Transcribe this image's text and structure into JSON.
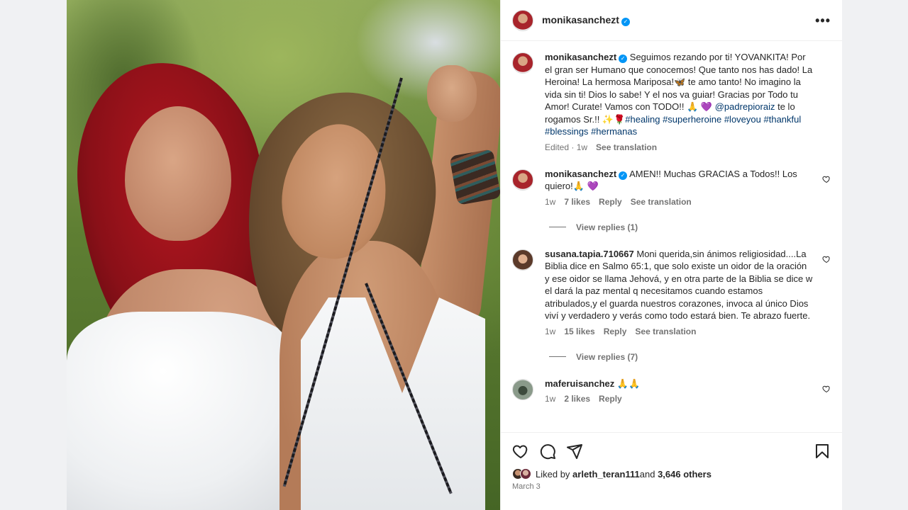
{
  "post": {
    "author": "monikasanchezt",
    "verified": true,
    "photo_alt": ""
  },
  "header": {
    "username": "monikasanchezt",
    "more": "•••"
  },
  "caption": {
    "username": "monikasanchezt",
    "text_part1": "Seguimos rezando por ti! YOVANKITA! Por el gran ser Humano que conocemos! Que tanto nos has dado! La Heroina! La hermosa Mariposa!🦋 te amo tanto! No imagino la vida sin ti! Dios lo sabe! Y el nos va guiar! Gracias por Todo tu Amor! Curate! Vamos con TODO!! 🙏 💜 ",
    "mention": "@padrepioraiz",
    "text_part2": " te lo rogamos Sr.!! ✨🌹",
    "hashtags": [
      "#healing",
      "#superheroine",
      "#loveyou",
      "#thankful",
      "#blessings",
      "#hermanas"
    ],
    "edited": "Edited",
    "time": "1w",
    "translate": "See translation"
  },
  "comments": [
    {
      "username": "monikasanchezt",
      "verified": true,
      "text": "AMEN!! Muchas GRACIAS a Todos!! Los quiero!🙏 💜",
      "time": "1w",
      "likes": "7 likes",
      "reply": "Reply",
      "translate": "See translation",
      "view_replies": "View replies (1)"
    },
    {
      "username": "susana.tapia.710667",
      "verified": false,
      "text": "Moni querida,sin ánimos religiosidad....La Biblia dice en Salmo 65:1, que solo existe un oidor de la oración y ese oidor se llama Jehová, y en otra parte de la Biblia se dice w el dará la paz mental q necesitamos cuando estamos atribulados,y el guarda nuestros corazones, invoca al único Dios viví y verdadero y verás como todo estará bien. Te abrazo fuerte.",
      "time": "1w",
      "likes": "15 likes",
      "reply": "Reply",
      "translate": "See translation",
      "view_replies": "View replies (7)"
    },
    {
      "username": "maferuisanchez",
      "verified": false,
      "text": "🙏🙏",
      "time": "1w",
      "likes": "2 likes",
      "reply": "Reply"
    }
  ],
  "footer": {
    "liked_prefix": "Liked by ",
    "liked_user": "arleth_teran111",
    "liked_and": " and ",
    "liked_others": "3,646 others",
    "date": "March 3"
  },
  "icons": {
    "like": "heart-icon",
    "comment": "comment-icon",
    "share": "share-icon",
    "save": "bookmark-icon",
    "more": "more-icon",
    "verified": "verified-badge-icon"
  },
  "colors": {
    "verified": "#0095f6",
    "link": "#00376b",
    "muted": "#737373",
    "text": "#262626"
  }
}
